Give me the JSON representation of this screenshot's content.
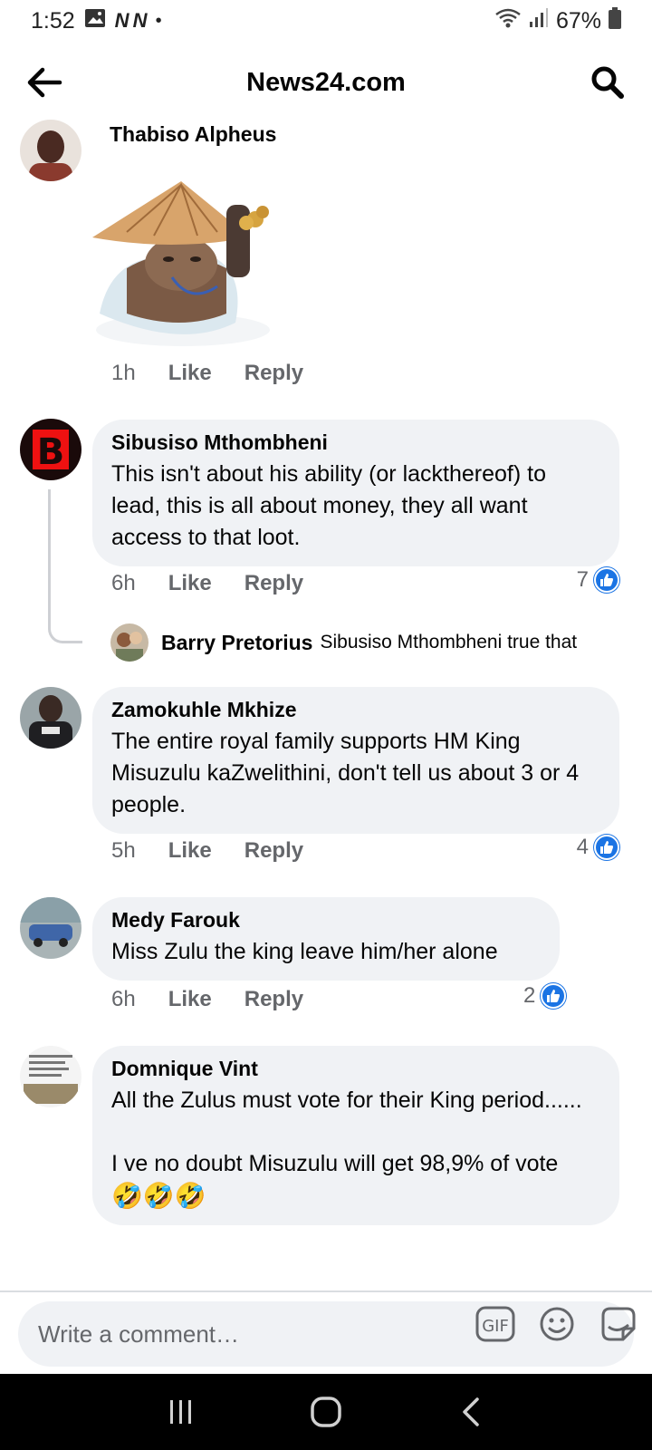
{
  "status_bar": {
    "time": "1:52",
    "network_marks": "N N",
    "battery": "67%"
  },
  "header": {
    "title": "News24.com"
  },
  "actions": {
    "like": "Like",
    "reply": "Reply"
  },
  "comments": [
    {
      "author": "Thabiso Alpheus",
      "time": "1h",
      "sticker": "sticker-icon"
    },
    {
      "author": "Sibusiso Mthombheni",
      "text": "This isn't about his ability (or lackthereof) to lead, this is all about money, they all want access to that loot.",
      "time": "6h",
      "reactions": "7"
    },
    {
      "author": "Zamokuhle Mkhize",
      "text": "The entire royal family supports HM King Misuzulu kaZwelithini, don't tell us about 3 or 4 people.",
      "time": "5h",
      "reactions": "4"
    },
    {
      "author": "Medy Farouk",
      "text": "Miss Zulu the king leave him/her alone",
      "time": "6h",
      "reactions": "2"
    },
    {
      "author": "Domnique Vint",
      "text": "All the Zulus must vote for their King period......\n\nI ve no doubt Misuzulu will get 98,9% of vote",
      "emojis": "🤣🤣🤣"
    }
  ],
  "reply": {
    "author": "Barry Pretorius",
    "text": "Sibusiso Mthombheni true that"
  },
  "composer": {
    "placeholder": "Write a comment…",
    "gif_label": "GIF"
  },
  "colors": {
    "accent": "#1b74e4",
    "bubble": "#f0f2f5",
    "meta_text": "#65676b"
  }
}
